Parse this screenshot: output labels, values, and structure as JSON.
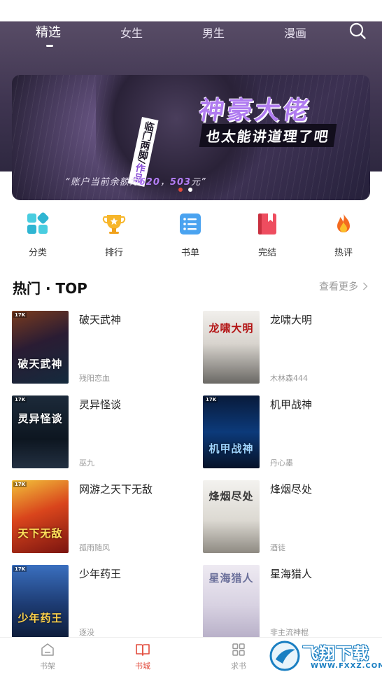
{
  "tabs": [
    {
      "label": "精选",
      "active": true
    },
    {
      "label": "女生",
      "active": false
    },
    {
      "label": "男生",
      "active": false
    },
    {
      "label": "漫画",
      "active": false
    }
  ],
  "banner": {
    "title": "神豪大佬",
    "subtitle": "也太能讲道理了吧",
    "author_name": "临门两脚",
    "author_suffix": "作品",
    "quote_prefix": "“账户当前余额为",
    "quote_num1": "620",
    "quote_sep": "，",
    "quote_num2": "503",
    "quote_suffix": "元”",
    "page_count": 2,
    "current_page": 1
  },
  "categories": [
    {
      "label": "分类",
      "icon": "grid-icon"
    },
    {
      "label": "排行",
      "icon": "trophy-icon"
    },
    {
      "label": "书单",
      "icon": "list-icon"
    },
    {
      "label": "完结",
      "icon": "bookmark-icon"
    },
    {
      "label": "热评",
      "icon": "flame-icon"
    }
  ],
  "section": {
    "title": "热门 · TOP",
    "more_label": "查看更多"
  },
  "books": [
    {
      "title": "破天武神",
      "author": "残阳恋血",
      "cover_text": "破天武神",
      "cover_badge": "17K"
    },
    {
      "title": "龙啸大明",
      "author": "木林森444",
      "cover_text": "龙啸大明",
      "cover_badge": ""
    },
    {
      "title": "灵异怪谈",
      "author": "巫九",
      "cover_text": "灵异怪谈",
      "cover_badge": "17K"
    },
    {
      "title": "机甲战神",
      "author": "丹心墨",
      "cover_text": "机甲战神",
      "cover_badge": "17K"
    },
    {
      "title": "网游之天下无敌",
      "author": "孤雨随风",
      "cover_text": "天下无敌",
      "cover_badge": "17K"
    },
    {
      "title": "烽烟尽处",
      "author": "酒徒",
      "cover_text": "烽烟尽处",
      "cover_badge": ""
    },
    {
      "title": "少年药王",
      "author": "逐没",
      "cover_text": "少年药王",
      "cover_badge": "17K"
    },
    {
      "title": "星海猎人",
      "author": "非主流神棍",
      "cover_text": "星海猎人",
      "cover_badge": ""
    }
  ],
  "bottom_nav": [
    {
      "label": "书架",
      "icon": "bookshelf-icon",
      "active": false
    },
    {
      "label": "书城",
      "icon": "open-book-icon",
      "active": true
    },
    {
      "label": "求书",
      "icon": "apps-icon",
      "active": false
    }
  ],
  "watermark": {
    "main": "飞翔下载",
    "url": "WWW.FXXZ.COM"
  },
  "colors": {
    "accent": "#e24a3b",
    "banner_title": "#b07cf0",
    "header_bg": "#4a3f5c"
  }
}
